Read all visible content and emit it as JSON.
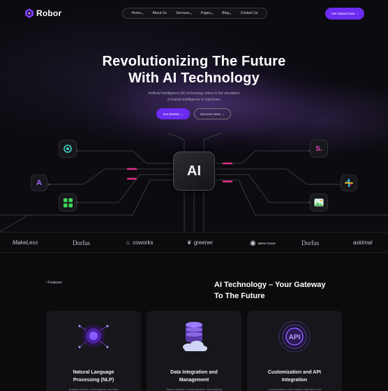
{
  "brand": {
    "name": "Robor",
    "color": "#6b2bf0"
  },
  "nav": {
    "items": [
      {
        "label": "Home",
        "dropdown": true
      },
      {
        "label": "About Us",
        "dropdown": false
      },
      {
        "label": "Services",
        "dropdown": true
      },
      {
        "label": "Pages",
        "dropdown": true
      },
      {
        "label": "Blog",
        "dropdown": true
      },
      {
        "label": "Contact Us",
        "dropdown": false
      }
    ],
    "cta_label": "Get Started Now",
    "cta_arrow": "›"
  },
  "hero": {
    "headline_line1": "Revolutionizing The Future",
    "headline_line2": "With AI Technology",
    "subtitle_line1": "Artificial Intelligence (AI) technology refers to the simulation",
    "subtitle_line2": "of human intelligence in machines.",
    "primary_button": "Get Started →",
    "secondary_button": "Discover More →",
    "chip_label": "AI"
  },
  "nodes": [
    {
      "name": "chatgpt-node",
      "glyph": "◎",
      "color": "#3ed3c8"
    },
    {
      "name": "adobe-node",
      "glyph": "A",
      "color": "#a06bff"
    },
    {
      "name": "grid-node",
      "glyph": "▦",
      "color": "#3fd65a"
    },
    {
      "name": "skype-node",
      "glyph": "S.",
      "color": "#e64bc7"
    },
    {
      "name": "slack-node",
      "glyph": "✚",
      "color": "#e8b02a"
    },
    {
      "name": "image-node",
      "glyph": "▣",
      "color": "#5bc86b"
    }
  ],
  "brands": {
    "items": [
      "MakeLess",
      "Dorfus",
      "coworks",
      "greener",
      "SEEN TODAY",
      "Dorfus",
      "askimat"
    ]
  },
  "features": {
    "tag": "• Features",
    "title_line1": "AI Technology – Your Gateway",
    "title_line2": "To The Future",
    "cards": [
      {
        "title_line1": "Natural Language",
        "title_line2": "Processing (NLP)",
        "desc": "Enables Robots, chat systems, and text",
        "icon": "nlp-brain-icon"
      },
      {
        "title_line1": "Data Integration and",
        "title_line2": "Management",
        "desc": "Secure transfer of data pipeline, data loading",
        "icon": "database-cloud-icon"
      },
      {
        "title_line1": "Customization and API",
        "title_line2": "Integration",
        "desc": "Customization of the chatbot interface to fit",
        "icon": "api-chip-icon",
        "api_label": "API"
      }
    ]
  },
  "colors": {
    "accent": "#6b2bf0",
    "background": "#0b0b0d",
    "card": "#17171b",
    "pink_trace": "#e0308a"
  }
}
